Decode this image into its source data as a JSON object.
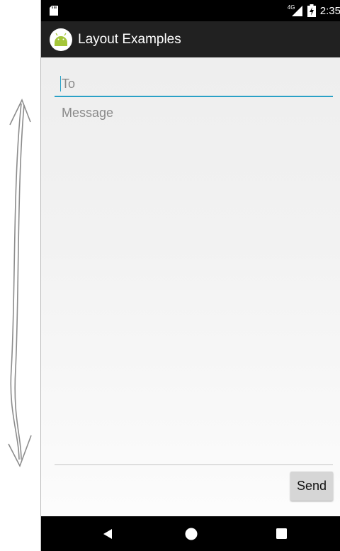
{
  "status_bar": {
    "network_label": "4G",
    "time": "2:35",
    "icons": [
      "sd-card-icon",
      "signal-icon",
      "battery-charging-icon"
    ]
  },
  "action_bar": {
    "title": "Layout Examples",
    "icon": "android-icon"
  },
  "form": {
    "to_placeholder": "To",
    "message_placeholder": "Message",
    "send_label": "Send"
  },
  "nav_bar": {
    "icons": [
      "back-icon",
      "home-icon",
      "recents-icon"
    ]
  },
  "annotation": {
    "icon": "double-arrow-icon"
  },
  "colors": {
    "accent": "#2aa1c7",
    "action_bar": "#212121",
    "status_bar": "#000000",
    "hint_text": "#8a8a8a",
    "button": "#d6d6d6",
    "android_green": "#a4c639"
  }
}
